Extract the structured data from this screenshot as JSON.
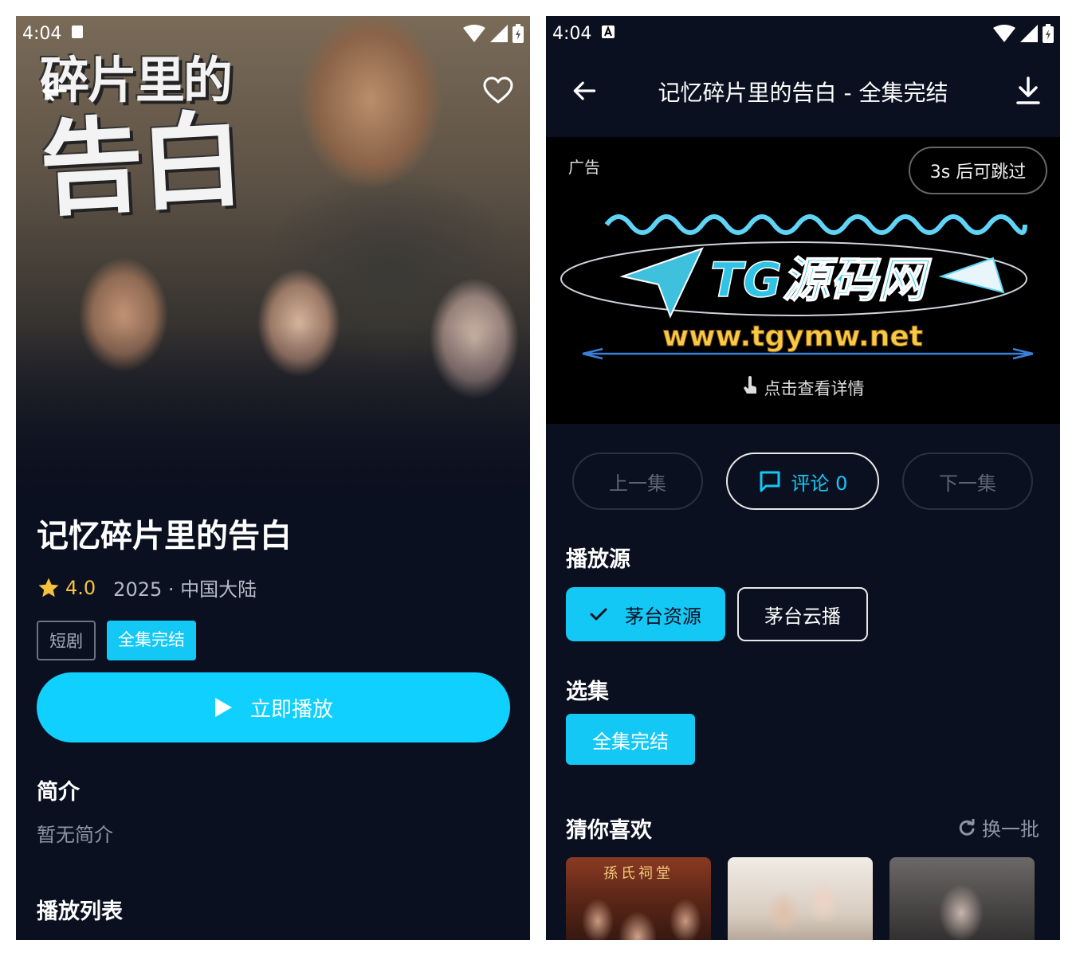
{
  "left": {
    "status": {
      "time": "4:04"
    },
    "poster": {
      "line1": "碎片里的",
      "line2": "告白"
    },
    "show": {
      "title": "记忆碎片里的告白",
      "rating": "4.0",
      "meta": "2025 · 中国大陆",
      "tags": [
        "短剧",
        "全集完结"
      ]
    },
    "play_label": "立即播放",
    "intro_heading": "简介",
    "intro_text": "暂无简介",
    "playlist_heading": "播放列表"
  },
  "right": {
    "status": {
      "time": "4:04"
    },
    "header_title": "记忆碎片里的告白 - 全集完结",
    "ad": {
      "label": "广告",
      "skip": "3s 后可跳过",
      "brand": "TG源码网",
      "url": "www.tgymw.net",
      "detail": "点击查看详情"
    },
    "nav": {
      "prev": "上一集",
      "comment": "评论 0",
      "next": "下一集"
    },
    "source_heading": "播放源",
    "sources": [
      "茅台资源",
      "茅台云播"
    ],
    "episode_heading": "选集",
    "episode_button": "全集完结",
    "recommend_heading": "猜你喜欢",
    "refresh_label": "换一批",
    "thumb1_caption": "孫氏祠堂"
  },
  "colors": {
    "accent": "#14c8f5",
    "background": "#0b1020",
    "star": "#f5c33b"
  },
  "icons": [
    "back-arrow-icon",
    "heart-icon",
    "star-icon",
    "play-icon",
    "download-icon",
    "comment-icon",
    "check-icon",
    "refresh-icon",
    "touch-icon",
    "wifi-icon",
    "signal-icon",
    "battery-icon"
  ]
}
